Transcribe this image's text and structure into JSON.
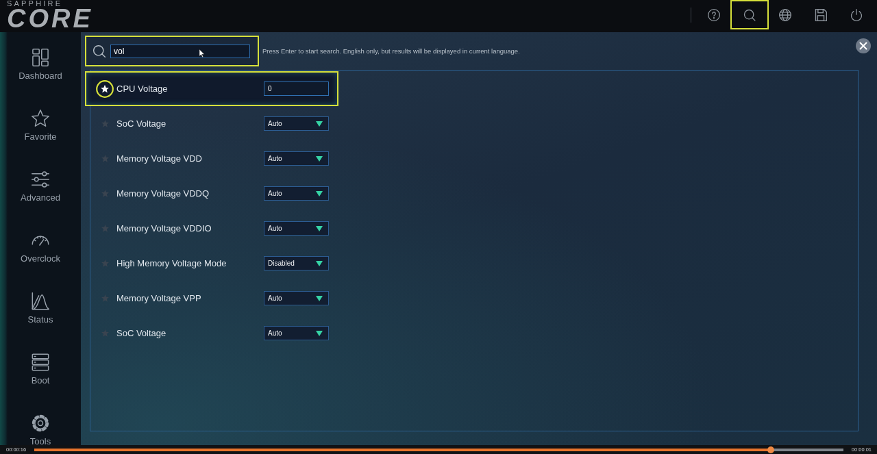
{
  "header": {
    "brand": "SAPPHIRE",
    "logo": "CORE",
    "toolbar": [
      {
        "kind": "help",
        "highlighted": false
      },
      {
        "kind": "search",
        "highlighted": true
      },
      {
        "kind": "globe",
        "highlighted": false
      },
      {
        "kind": "save",
        "highlighted": false
      },
      {
        "kind": "power",
        "highlighted": false
      }
    ]
  },
  "sidebar": {
    "items": [
      {
        "kind": "grid",
        "label": "Dashboard"
      },
      {
        "kind": "star",
        "label": "Favorite"
      },
      {
        "kind": "sliders",
        "label": "Advanced"
      },
      {
        "kind": "gauge",
        "label": "Overclock"
      },
      {
        "kind": "chart",
        "label": "Status"
      },
      {
        "kind": "stack",
        "label": "Boot"
      },
      {
        "kind": "gear",
        "label": "Tools"
      }
    ]
  },
  "search": {
    "value": "vol",
    "highlighted": true,
    "hint": "Press Enter to start search. English only, but results will be displayed in current language."
  },
  "results": [
    {
      "label": "CPU Voltage",
      "kind": "input",
      "value": "0",
      "favorite": true,
      "selected": true,
      "highlighted": true
    },
    {
      "label": "SoC Voltage",
      "kind": "dropdown",
      "value": "Auto",
      "favorite": false,
      "selected": false,
      "highlighted": false
    },
    {
      "label": "Memory Voltage VDD",
      "kind": "dropdown",
      "value": "Auto",
      "favorite": false,
      "selected": false,
      "highlighted": false
    },
    {
      "label": "Memory Voltage VDDQ",
      "kind": "dropdown",
      "value": "Auto",
      "favorite": false,
      "selected": false,
      "highlighted": false
    },
    {
      "label": "Memory Voltage VDDIO",
      "kind": "dropdown",
      "value": "Auto",
      "favorite": false,
      "selected": false,
      "highlighted": false
    },
    {
      "label": "High Memory Voltage Mode",
      "kind": "dropdown",
      "value": "Disabled",
      "favorite": false,
      "selected": false,
      "highlighted": false
    },
    {
      "label": "Memory Voltage VPP",
      "kind": "dropdown",
      "value": "Auto",
      "favorite": false,
      "selected": false,
      "highlighted": false
    },
    {
      "label": "SoC Voltage",
      "kind": "dropdown",
      "value": "Auto",
      "favorite": false,
      "selected": false,
      "highlighted": false
    }
  ],
  "player": {
    "elapsed": "00:00:16",
    "total": "00:00:01",
    "level": 0.91
  }
}
